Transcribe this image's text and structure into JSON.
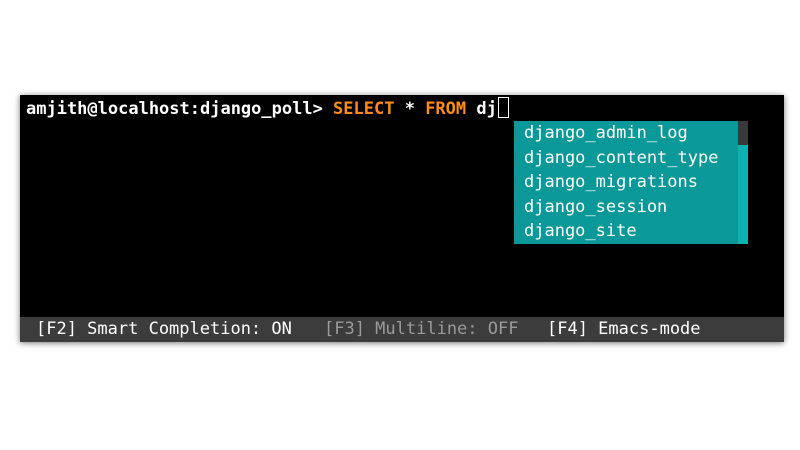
{
  "prompt": {
    "user_host_db": "amjith@localhost:django_poll> ",
    "keyword_select": "SELECT",
    "star": " * ",
    "keyword_from": "FROM",
    "typed": " dj"
  },
  "completion_menu": {
    "items": [
      "django_admin_log",
      "django_content_type",
      "django_migrations",
      "django_session",
      "django_site"
    ]
  },
  "toolbar": {
    "smart_completion": "[F2] Smart Completion: ON",
    "multiline": "[F3] Multiline: OFF",
    "key_mode": "[F4] Emacs-mode"
  },
  "colors": {
    "keyword": "#ff8c1a",
    "menu_background": "#0b9898",
    "toolbar_background": "#3c3c3c"
  }
}
